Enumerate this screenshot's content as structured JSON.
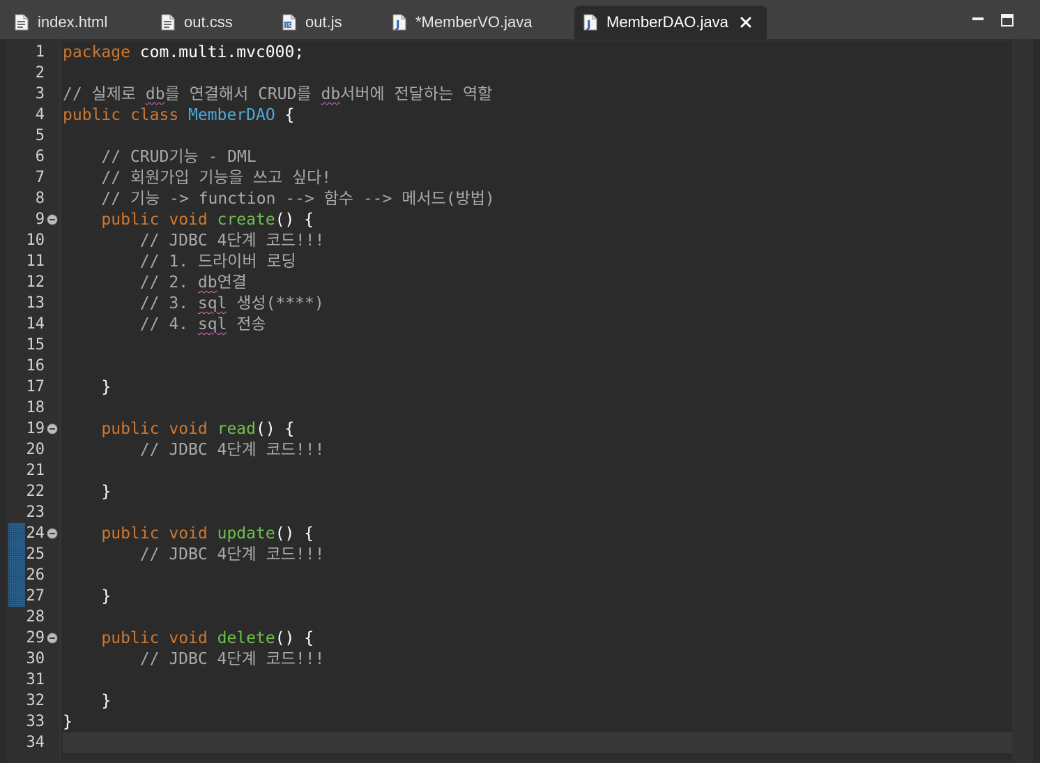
{
  "tabs": [
    {
      "label": "index.html",
      "icon": "html-file-icon",
      "active": false
    },
    {
      "label": "out.css",
      "icon": "css-file-icon",
      "active": false
    },
    {
      "label": "out.js",
      "icon": "js-file-icon",
      "active": false
    },
    {
      "label": "*MemberVO.java",
      "icon": "java-file-icon",
      "active": false
    },
    {
      "label": "MemberDAO.java",
      "icon": "java-file-icon",
      "active": true
    }
  ],
  "window_controls": {
    "minimize": "minimize-icon",
    "maximize": "maximize-icon"
  },
  "editor": {
    "current_line": 34,
    "folded_lines": [
      9,
      19,
      24,
      29
    ],
    "changed_lines": [
      24,
      25,
      26,
      27
    ],
    "lines": [
      {
        "n": "1"
      },
      {
        "n": "2"
      },
      {
        "n": "3"
      },
      {
        "n": "4"
      },
      {
        "n": "5"
      },
      {
        "n": "6"
      },
      {
        "n": "7"
      },
      {
        "n": "8"
      },
      {
        "n": "9"
      },
      {
        "n": "10"
      },
      {
        "n": "11"
      },
      {
        "n": "12"
      },
      {
        "n": "13"
      },
      {
        "n": "14"
      },
      {
        "n": "15"
      },
      {
        "n": "16"
      },
      {
        "n": "17"
      },
      {
        "n": "18"
      },
      {
        "n": "19"
      },
      {
        "n": "20"
      },
      {
        "n": "21"
      },
      {
        "n": "22"
      },
      {
        "n": "23"
      },
      {
        "n": "24"
      },
      {
        "n": "25"
      },
      {
        "n": "26"
      },
      {
        "n": "27"
      },
      {
        "n": "28"
      },
      {
        "n": "29"
      },
      {
        "n": "30"
      },
      {
        "n": "31"
      },
      {
        "n": "32"
      },
      {
        "n": "33"
      },
      {
        "n": "34"
      }
    ],
    "code": {
      "l1_kw": "package",
      "l1_rest": " com.multi.mvc000;",
      "l3_a": "// 실제로 ",
      "l3_db1": "db",
      "l3_b": "를 연결해서 CRUD를 ",
      "l3_db2": "db",
      "l3_c": "서버에 전달하는 역할",
      "l4_kw1": "public",
      "l4_kw2": "class",
      "l4_cls": "MemberDAO",
      "l4_brace": " {",
      "l6": "    // CRUD기능 - DML",
      "l7": "    // 회원가입 기능을 쓰고 싶다!",
      "l8": "    // 기능 -> function --> 함수 --> 메서드(방법)",
      "kw_public": "public",
      "kw_void": "void",
      "fn_create": "create",
      "fn_read": "read",
      "fn_update": "update",
      "fn_delete": "delete",
      "sig_tail": "() {",
      "jdbc": "        // JDBC 4단계 코드!!!",
      "l11": "        // 1. 드라이버 로딩",
      "l12_a": "        // 2. ",
      "l12_db": "db",
      "l12_b": "연결",
      "l13_a": "        // 3. ",
      "l13_sql": "sql",
      "l13_b": " 생성(****)",
      "l14_a": "        // 4. ",
      "l14_sql": "sql",
      "l14_b": " 전송",
      "close_inner": "    }",
      "close_outer": "}"
    }
  }
}
